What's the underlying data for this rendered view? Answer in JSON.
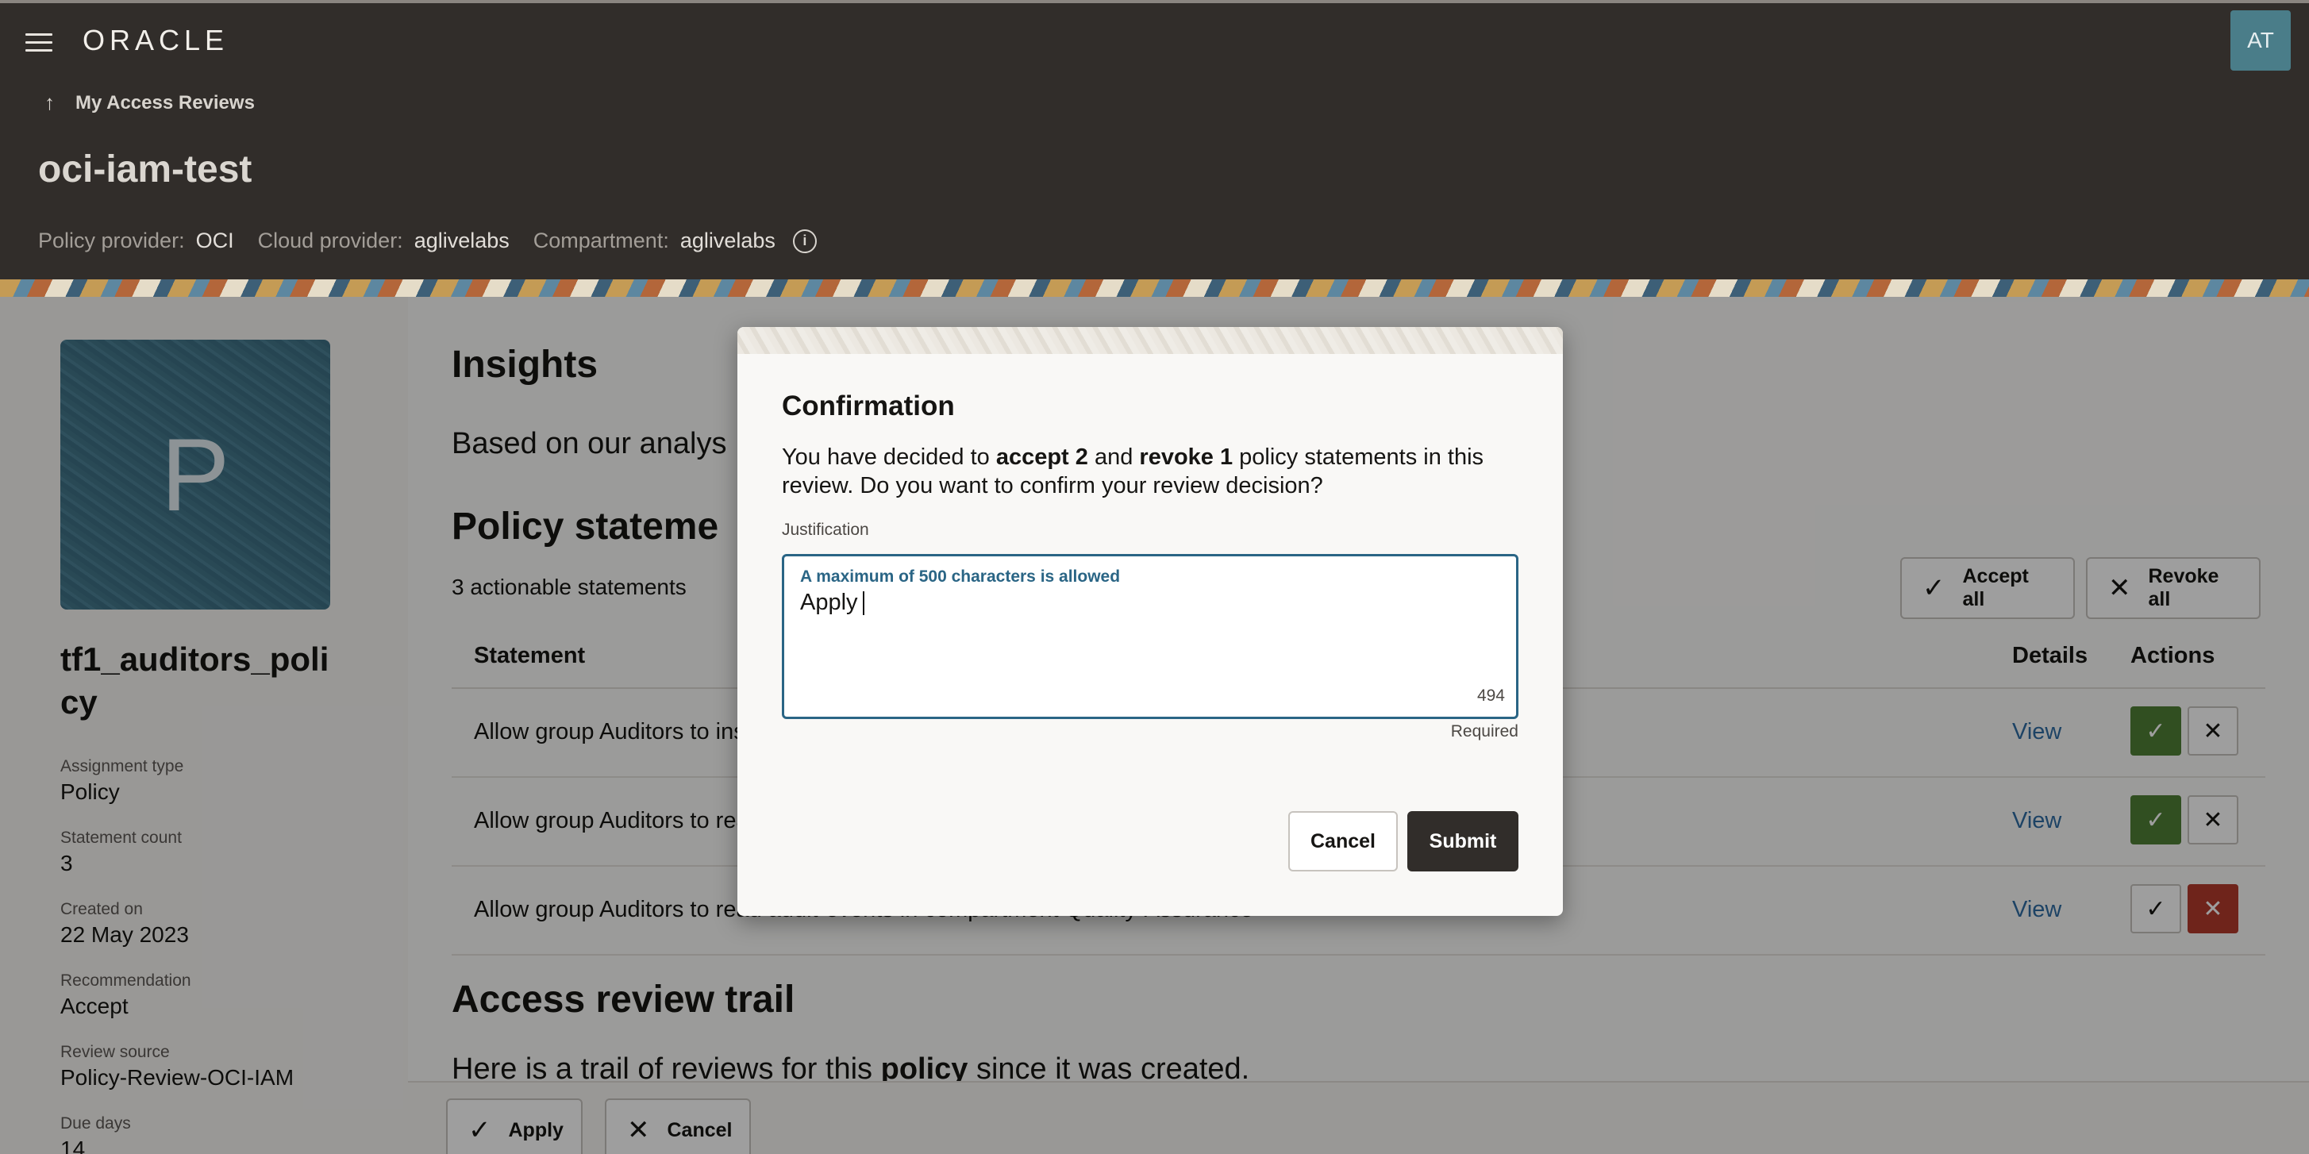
{
  "header": {
    "logo": "ORACLE",
    "user_initials": "AT",
    "back_link": "My Access Reviews",
    "title": "oci-iam-test",
    "meta": [
      {
        "label": "Policy provider:",
        "value": "OCI"
      },
      {
        "label": "Cloud provider:",
        "value": "aglivelabs"
      },
      {
        "label": "Compartment:",
        "value": "aglivelabs"
      }
    ]
  },
  "policy": {
    "avatar_letter": "P",
    "name": "tf1_auditors_policy",
    "properties": [
      {
        "label": "Assignment type",
        "value": "Policy"
      },
      {
        "label": "Statement count",
        "value": "3"
      },
      {
        "label": "Created on",
        "value": "22 May 2023"
      },
      {
        "label": "Recommendation",
        "value": "Accept"
      },
      {
        "label": "Review source",
        "value": "Policy-Review-OCI-IAM"
      },
      {
        "label": "Due days",
        "value": "14"
      }
    ]
  },
  "insights": {
    "title": "Insights",
    "text": "Based on our analys"
  },
  "statements": {
    "title": "Policy stateme",
    "count_text": "3 actionable statements",
    "accept_all": "Accept all",
    "revoke_all": "Revoke all",
    "columns": {
      "statement": "Statement",
      "details": "Details",
      "actions": "Actions"
    },
    "rows": [
      {
        "text": "Allow group Auditors to ins",
        "view": "View",
        "decision": "accept"
      },
      {
        "text": "Allow group Auditors to rea",
        "view": "View",
        "decision": "accept"
      },
      {
        "text": "Allow group Auditors to read audit-events in compartment Quality-Assurance",
        "view": "View",
        "decision": "revoke"
      }
    ]
  },
  "trail": {
    "title": "Access review trail",
    "text_before": "Here is a trail of reviews for this ",
    "text_bold": "policy",
    "text_after": " since it was created."
  },
  "footer": {
    "apply": "Apply",
    "cancel": "Cancel"
  },
  "dialog": {
    "title": "Confirmation",
    "msg_1": "You have decided to ",
    "msg_accept": "accept 2",
    "msg_2": " and ",
    "msg_revoke": "revoke 1",
    "msg_3": " policy statements in this review. Do you want to confirm your review decision?",
    "justification_label": "Justification",
    "hint": "A maximum of 500 characters is allowed",
    "value": "Apply",
    "counter": "494",
    "required": "Required",
    "cancel": "Cancel",
    "submit": "Submit"
  },
  "colors": {
    "header_bg": "#312d2a",
    "accept_green": "#508036",
    "revoke_red": "#b33a2c",
    "link_blue": "#2f6da4",
    "focus_blue": "#2a6585"
  }
}
